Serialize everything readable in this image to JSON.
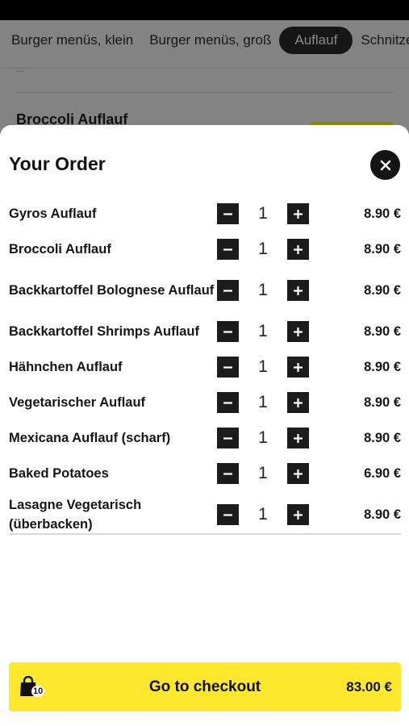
{
  "background": {
    "categories": [
      {
        "label": "Burger menüs, klein",
        "active": false
      },
      {
        "label": "Burger menüs, groß",
        "active": false
      },
      {
        "label": "Auflauf",
        "active": true
      },
      {
        "label": "Schnitzel",
        "active": false
      }
    ],
    "snippet": "...",
    "item_title": "Broccoli Auflauf"
  },
  "order": {
    "title": "Your Order",
    "close_icon": "close-icon",
    "items": [
      {
        "name": "Gyros Auflauf",
        "qty": "1",
        "price": "8.90 €"
      },
      {
        "name": "Broccoli Auflauf",
        "qty": "1",
        "price": "8.90 €"
      },
      {
        "name": "Backkartoffel Bolognese Auflauf",
        "qty": "1",
        "price": "8.90 €"
      },
      {
        "name": "Backkartoffel Shrimps Auflauf",
        "qty": "1",
        "price": "8.90 €"
      },
      {
        "name": "Hähnchen Auflauf",
        "qty": "1",
        "price": "8.90 €"
      },
      {
        "name": "Vegetarischer Auflauf",
        "qty": "1",
        "price": "8.90 €"
      },
      {
        "name": "Mexicana Auflauf (scharf)",
        "qty": "1",
        "price": "8.90 €"
      },
      {
        "name": "Baked Potatoes",
        "qty": "1",
        "price": "6.90 €"
      },
      {
        "name": "Lasagne Vegetarisch (überbacken)",
        "qty": "1",
        "price": "8.90 €"
      }
    ]
  },
  "checkout": {
    "label": "Go to checkout",
    "bag_count": "10",
    "total": "83.00 €",
    "accent_color": "#fde82d"
  }
}
